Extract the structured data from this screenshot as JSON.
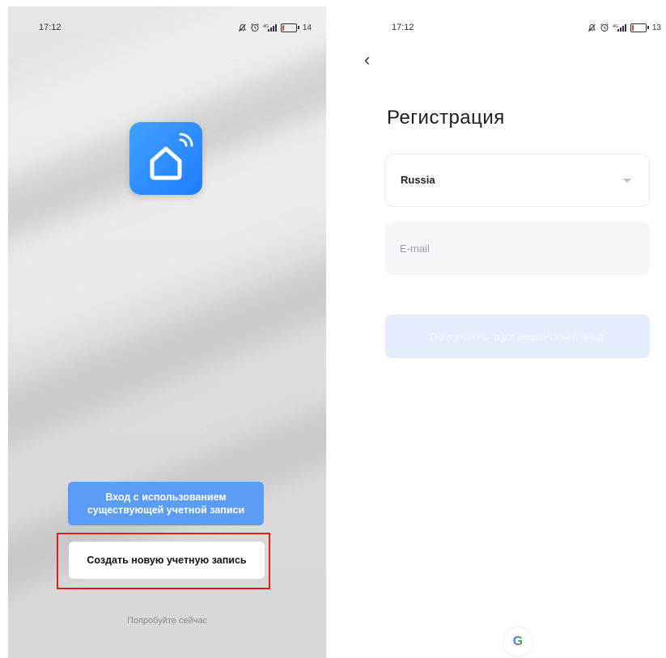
{
  "left_screen": {
    "status_bar": {
      "time": "17:12",
      "battery_pct": "14",
      "battery_level": 0.14
    },
    "app_icon": "smart-home-icon",
    "login_button_label": "Вход с использованием существующей учетной записи",
    "create_button_label": "Создать новую учетную запись",
    "try_now_label": "Попробуйте сейчас"
  },
  "right_screen": {
    "status_bar": {
      "time": "17:12",
      "battery_pct": "13",
      "battery_level": 0.13
    },
    "back_icon": "chevron-left-icon",
    "back_glyph": "‹",
    "title": "Регистрация",
    "country_value": "Russia",
    "email_placeholder": "E-mail",
    "email_value": "",
    "get_code_label": "Получить проверочный код",
    "google_icon": "google-icon",
    "google_glyph": "G"
  },
  "colors": {
    "primary_blue": "#5b9cf7",
    "highlight_red": "#e0201a",
    "disabled_button": "#e4edfc",
    "app_icon_blue": "#1f7dff",
    "battery_red": "#e53935"
  }
}
